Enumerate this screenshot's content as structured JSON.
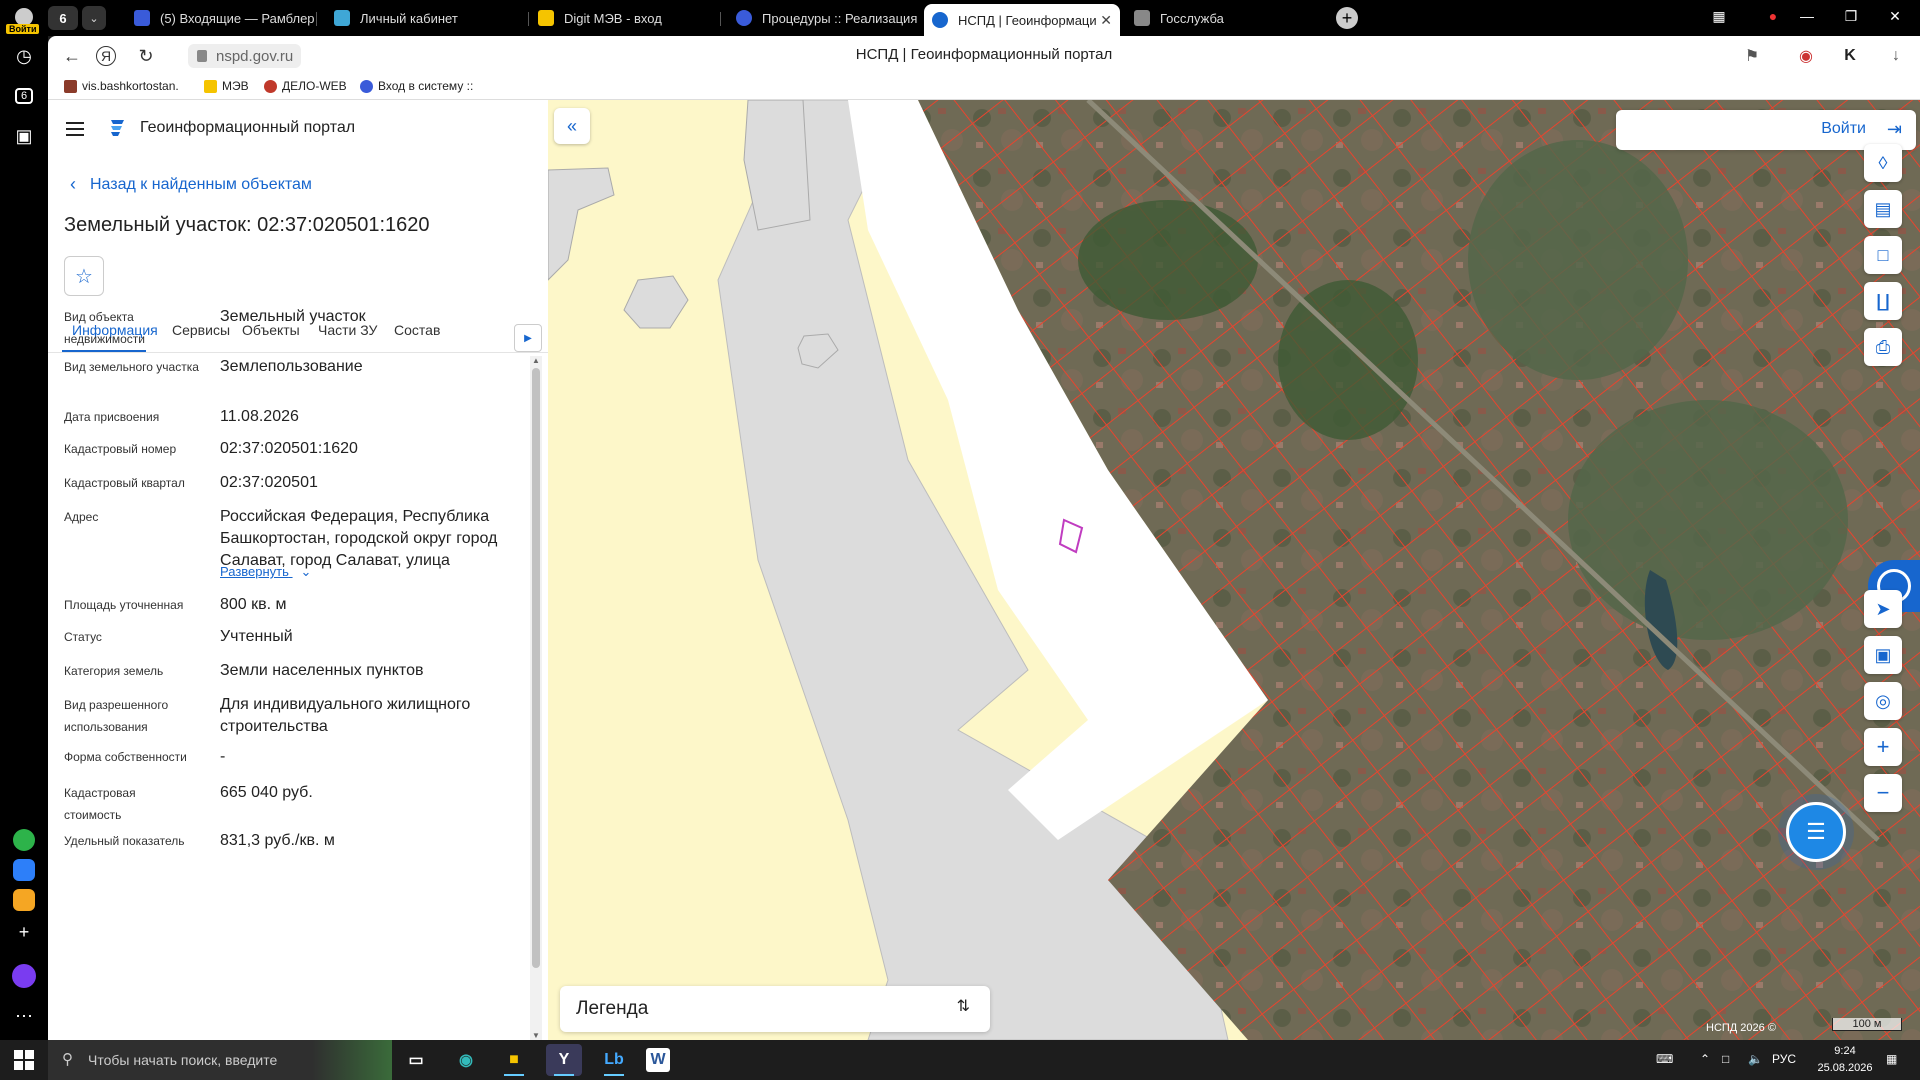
{
  "browser": {
    "tab_count": "6",
    "login_label": "Войти",
    "tabs": [
      {
        "label": "(5) Входящие — Рамблер",
        "color": "#3a5bd9"
      },
      {
        "label": "Личный кабинет",
        "color": "#3fa7d6"
      },
      {
        "label": "Digit МЭВ - вход",
        "color": "#f5c400"
      },
      {
        "label": "Процедуры :: Реализация",
        "color": "#3a5bd9"
      },
      {
        "label": "НСПД | Геоинформаци",
        "color": "#1766ce"
      },
      {
        "label": "Госслужба",
        "color": "#888888"
      }
    ],
    "url": "nspd.gov.ru",
    "page_title": "НСПД | Геоинформационный портал",
    "bookmarks": [
      "vis.bashkortostan.",
      "МЭВ",
      "ДЕЛО-WEB",
      "Вход в систему :: "
    ]
  },
  "portal": {
    "title": "Геоинформационный портал",
    "back_link": "Назад к найденным объектам",
    "object_title": "Земельный участок: 02:37:020501:1620",
    "tabs": [
      "Информация",
      "Сервисы",
      "Объекты",
      "Части ЗУ",
      "Состав"
    ],
    "expand_label": "Развернуть",
    "properties": [
      {
        "key": "Вид объекта недвижимости",
        "value": "Земельный участок"
      },
      {
        "key": "Вид земельного участка",
        "value": "Землепользование"
      },
      {
        "key": "Дата присвоения",
        "value": "11.08.2026"
      },
      {
        "key": "Кадастровый номер",
        "value": "02:37:020501:1620"
      },
      {
        "key": "Кадастровый квартал",
        "value": "02:37:020501"
      },
      {
        "key": "Адрес",
        "value": "Российская Федерация, Республика Башкортостан, городской округ город Салават, город Салават, улица"
      },
      {
        "key": "Площадь уточненная",
        "value": "800 кв. м"
      },
      {
        "key": "Статус",
        "value": "Учтенный"
      },
      {
        "key": "Категория земель",
        "value": "Земли населенных пунктов"
      },
      {
        "key": "Вид разрешенного использования",
        "value": "Для индивидуального жилищного строительства"
      },
      {
        "key": "Форма собственности",
        "value": "-"
      },
      {
        "key": "Кадастровая стоимость",
        "value": "665 040 руб."
      },
      {
        "key": "Удельный показатель",
        "value": "831,3 руб./кв. м"
      }
    ]
  },
  "map": {
    "login_label": "Войти",
    "legend_label": "Легенда",
    "copyright": "НСПД 2026 ©",
    "scale": "100 м"
  },
  "taskbar": {
    "search_placeholder": "Чтобы начать поиск, введите",
    "lang": "РУС",
    "time": "9:24",
    "date": "25.08.2026"
  },
  "colors": {
    "accent": "#1766ce",
    "map_yellow": "#fdf7c9",
    "parcel_red": "#e8442e"
  }
}
